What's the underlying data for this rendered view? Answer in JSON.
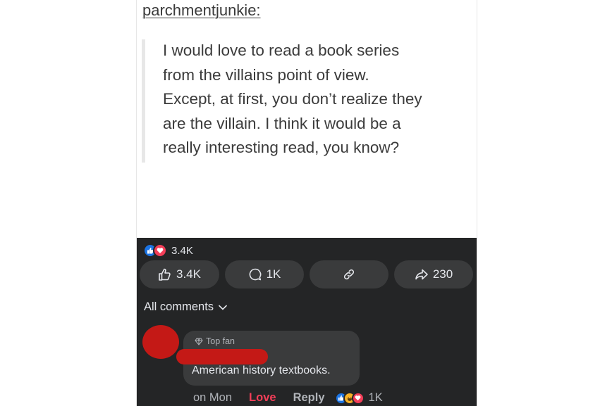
{
  "post": {
    "username": "parchmentjunkie:",
    "quote_lines": [
      "I would love to read a book series",
      "from the villains point of view.",
      "Except, at first, you don’t realize they",
      "are the villain. I think it would be a",
      "really interesting read, you know?"
    ]
  },
  "reactions": {
    "summary_count": "3.4K",
    "icons": [
      "like-icon",
      "love-icon"
    ]
  },
  "actions": {
    "like_count": "3.4K",
    "comment_count": "1K",
    "share_count": "230"
  },
  "comments": {
    "filter_label": "All comments",
    "items": [
      {
        "badge": "Top fan",
        "text": "American history textbooks.",
        "time": "on Mon",
        "love_label": "Love",
        "reply_label": "Reply",
        "reaction_count": "1K",
        "reaction_icons": [
          "like-icon",
          "haha-icon",
          "love-icon"
        ]
      }
    ]
  },
  "colors": {
    "dark_bg": "#242526",
    "button_bg": "#3a3b3c",
    "love_red": "#f33e58",
    "like_blue": "#1b74e4",
    "redaction_red": "#c41916"
  }
}
